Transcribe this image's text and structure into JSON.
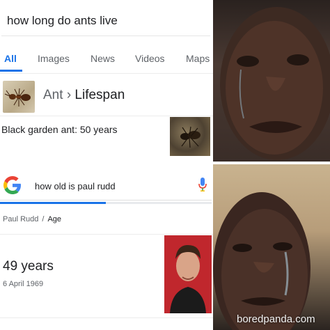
{
  "top_search": {
    "query": "how long do ants live",
    "tabs": [
      "All",
      "Images",
      "News",
      "Videos",
      "Maps"
    ],
    "result_heading_prefix": "Ant",
    "result_heading_arrow": "›",
    "result_heading_topic": "Lifespan",
    "answer": "Black garden ant: 50 years"
  },
  "bottom_search": {
    "query": "how old is paul rudd",
    "progress_fraction": 0.5,
    "breadcrumb_subject": "Paul Rudd",
    "breadcrumb_separator": "/",
    "breadcrumb_attribute": "Age",
    "age": "49 years",
    "birth_date": "6 April 1969"
  },
  "watermark": "boredpanda.com",
  "colors": {
    "accent": "#1a73e8",
    "google_blue": "#4285f4",
    "google_red": "#ea4335",
    "google_yellow": "#fbbc05",
    "google_green": "#34a853",
    "photo_backdrop_red": "#c0272d"
  }
}
